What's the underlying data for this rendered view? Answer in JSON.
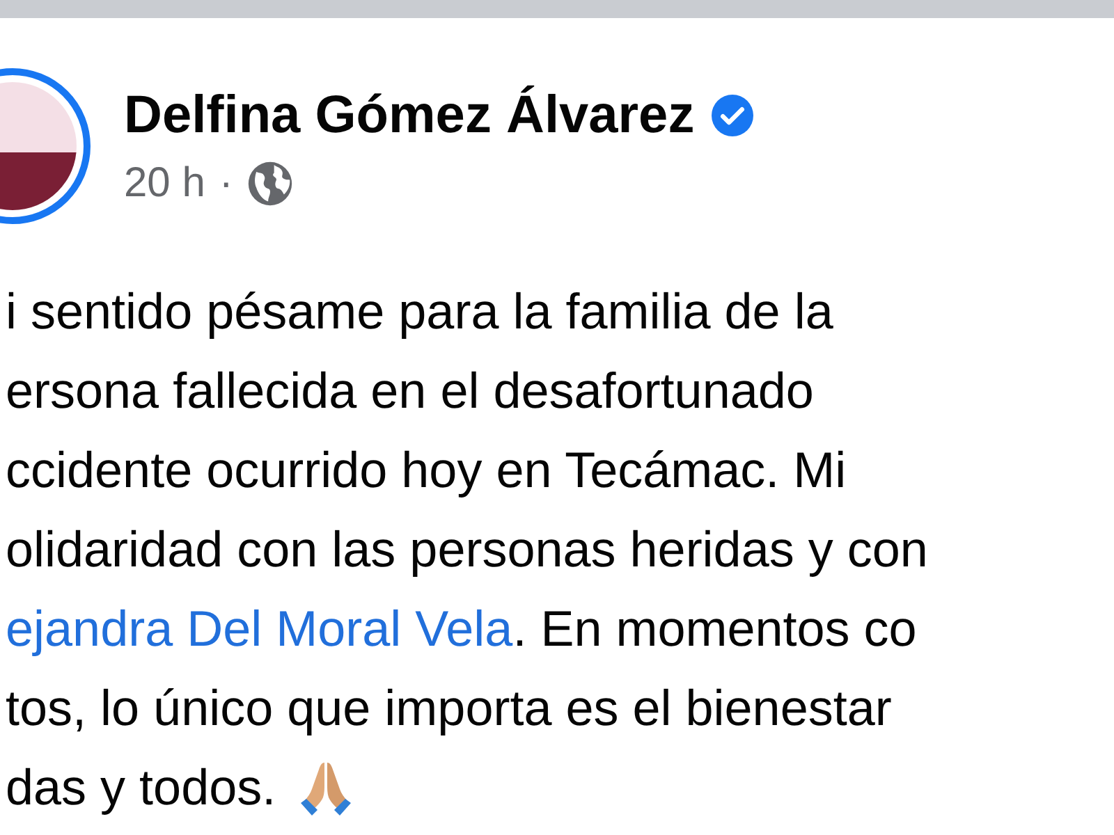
{
  "post": {
    "author": "Delfina Gómez Álvarez",
    "verified": true,
    "time": "20 h",
    "separator": "·",
    "lines": [
      {
        "kind": "text",
        "text": "i sentido pésame para la familia de la"
      },
      {
        "kind": "text",
        "text": "ersona fallecida en el desafortunado"
      },
      {
        "kind": "text",
        "text": "ccidente ocurrido hoy en Tecámac. Mi"
      },
      {
        "kind": "text",
        "text": "olidaridad con las personas heridas y con"
      },
      {
        "kind": "mention",
        "mention": "ejandra Del Moral Vela",
        "text": ". En momentos co"
      },
      {
        "kind": "text",
        "text": "tos, lo único que importa es el bienestar"
      },
      {
        "kind": "text",
        "text": "das y todos.",
        "emoji": true
      }
    ]
  }
}
